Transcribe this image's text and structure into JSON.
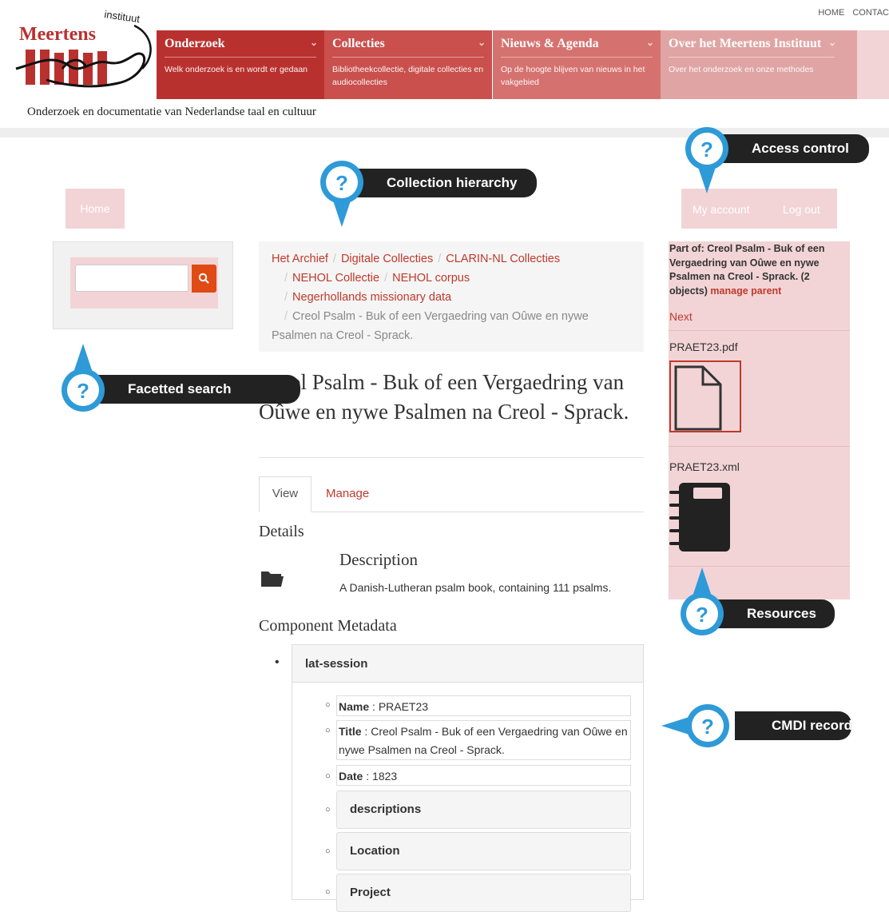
{
  "top_links": [
    "HOME",
    "CONTAC"
  ],
  "logo": {
    "name": "Meertens",
    "sub": "instituut"
  },
  "nav": [
    {
      "title": "Onderzoek",
      "desc": "Welk onderzoek is en wordt er gedaan",
      "color": "#b9312f"
    },
    {
      "title": "Collecties",
      "desc": "Bibliotheekcollectie, digitale collecties en audiocollecties",
      "color": "#c9504d"
    },
    {
      "title": "Nieuws & Agenda",
      "desc": "Op de hoogte blijven van nieuws in het vakgebied",
      "color": "#d5726f"
    },
    {
      "title": "Over het Meertens Instituut",
      "desc": "Over het onderzoek en onze methodes",
      "color": "#e0a4a4"
    }
  ],
  "tagline": "Onderzoek en documentatie van Nederlandse taal en cultuur",
  "home_button": "Home",
  "account": {
    "my_account": "My account",
    "log_out": "Log out"
  },
  "breadcrumb": {
    "items": [
      "Het Archief",
      "Digitale Collecties",
      "CLARIN-NL Collecties",
      "NEHOL Collectie",
      "NEHOL corpus",
      "Negerhollands missionary data"
    ],
    "current": "Creol Psalm - Buk of een Vergaedring van Oûwe en nywe Psalmen na Creol - Sprack."
  },
  "title": "Creol Psalm - Buk of een Vergaedring van Oûwe en nywe Psalmen na Creol - Sprack.",
  "tabs": {
    "view": "View",
    "manage": "Manage"
  },
  "details_heading": "Details",
  "description": {
    "heading": "Description",
    "text": "A Danish-Lutheran psalm book, containing 111 psalms."
  },
  "component_metadata_heading": "Component Metadata",
  "lat_session": "lat-session",
  "fields": {
    "name": {
      "label": "Name",
      "value": "PRAET23"
    },
    "title": {
      "label": "Title",
      "value": "Creol Psalm - Buk of een Vergaedring van Oûwe en nywe Psalmen na Creol - Sprack."
    },
    "date": {
      "label": "Date",
      "value": "1823"
    }
  },
  "subsections": [
    "descriptions",
    "Location",
    "Project"
  ],
  "sidebar": {
    "part_of": "Part of: Creol Psalm - Buk of een Vergaedring van Oûwe en nywe Psalmen na Creol - Sprack. (2 objects)",
    "manage_parent": "manage parent",
    "next": "Next",
    "files": [
      "PRAET23.pdf",
      "PRAET23.xml"
    ]
  },
  "callouts": {
    "access_control": "Access control",
    "collection_hierarchy": "Collection hierarchy",
    "facetted_search": "Facetted search",
    "resources": "Resources",
    "cmdi_record": "CMDI record"
  },
  "colors": {
    "accent": "#c0392b",
    "callout_blue": "#2e9ad8",
    "pink": "#f2d4d6",
    "search_button": "#e04a14"
  },
  "icons": [
    "search-icon",
    "folder-icon",
    "file-icon",
    "notebook-icon",
    "help-icon",
    "chevron-down-icon"
  ]
}
